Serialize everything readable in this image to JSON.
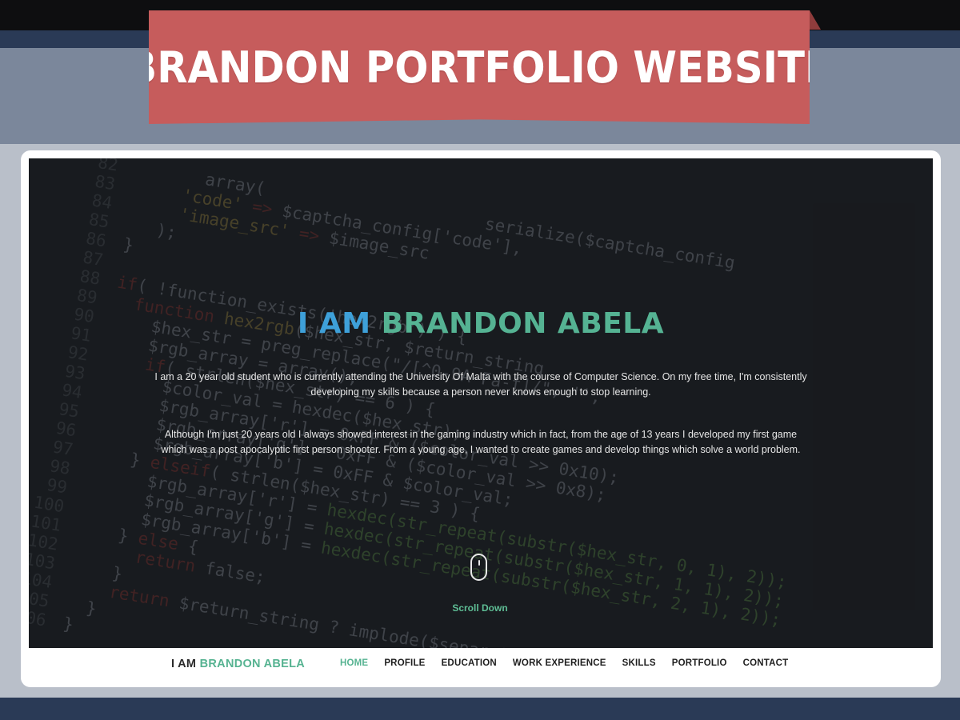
{
  "banner": {
    "title": "BRANDON PORTFOLIO WEBSITE"
  },
  "hero": {
    "title_part1": "I AM",
    "title_part2": "BRANDON ABELA",
    "paragraph1": [
      "I am a 20 year old student who is currently attending the University Of Malta with the course of Computer Science. On my free time, I'm consistently",
      "developing my skills because a person never knows enough to stop learning."
    ],
    "paragraph2": [
      "Although I'm just 20 years old I always showed interest in the gaming industry which in fact, from the age of 13 years I developed my first game",
      "which was a post apocalyptic first person shooter. From a young age, I wanted to create games and develop things which solve a world problem."
    ],
    "scroll_label": "Scroll Down",
    "scroll_icon": "mouse-icon"
  },
  "navbar": {
    "brand_part1": "I AM",
    "brand_part2": "BRANDON ABELA",
    "items": [
      {
        "label": "HOME",
        "active": true
      },
      {
        "label": "PROFILE",
        "active": false
      },
      {
        "label": "EDUCATION",
        "active": false
      },
      {
        "label": "WORK EXPERIENCE",
        "active": false
      },
      {
        "label": "SKILLS",
        "active": false
      },
      {
        "label": "PORTFOLIO",
        "active": false
      },
      {
        "label": "CONTACT",
        "active": false
      }
    ]
  },
  "colors": {
    "banner_red": "#c65c5c",
    "accent_blue": "#3ea0d9",
    "accent_green": "#56b391",
    "hero_bg": "#1a1c20",
    "frame_navy": "#2a3a56"
  }
}
